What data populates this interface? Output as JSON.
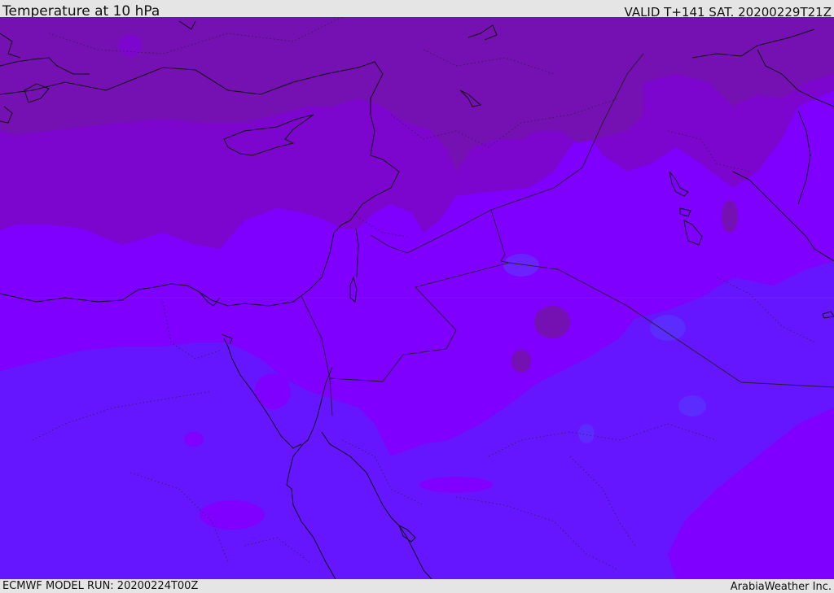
{
  "header": {
    "title": "Temperature at 10 hPa",
    "valid_time": "VALID T+141 SAT. 20200229T21Z"
  },
  "footer": {
    "model_run": "ECMWF MODEL RUN: 20200224T00Z",
    "credit": "ArabiaWeather Inc."
  },
  "map": {
    "variable": "temperature",
    "level": "10 hPa",
    "colors": {
      "coldest_band": "#7510b2",
      "cold_band": "#7d06cf",
      "mid_band": "#7f00ff",
      "warm_band": "#6516ff",
      "blob_accent": "#5b2bff",
      "coastline": "#111111",
      "border": "#222222"
    }
  }
}
